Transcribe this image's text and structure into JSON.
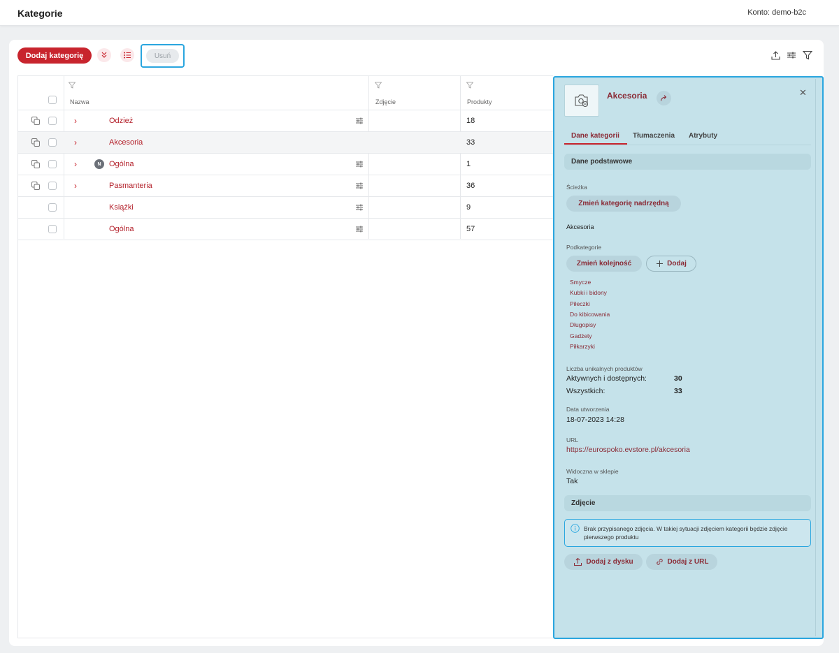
{
  "header": {
    "title": "Kategorie",
    "account": "Konto: demo-b2c"
  },
  "toolbar": {
    "add_label": "Dodaj kategorię",
    "delete_label": "Usuń"
  },
  "table": {
    "columns": {
      "name": "Nazwa",
      "image": "Zdjęcie",
      "products": "Produkty"
    },
    "rows": [
      {
        "name": "Odzież",
        "count": "18",
        "expandable": true,
        "badge": ""
      },
      {
        "name": "Akcesoria",
        "count": "33",
        "expandable": true,
        "badge": ""
      },
      {
        "name": "Ogólna",
        "count": "1",
        "expandable": true,
        "badge": "N"
      },
      {
        "name": "Pasmanteria",
        "count": "36",
        "expandable": true,
        "badge": ""
      },
      {
        "name": "Książki",
        "count": "9",
        "expandable": false,
        "badge": ""
      },
      {
        "name": "Ogólna",
        "count": "57",
        "expandable": false,
        "badge": ""
      }
    ]
  },
  "panel": {
    "title": "Akcesoria",
    "tabs": [
      "Dane kategorii",
      "Tłumaczenia",
      "Atrybuty"
    ],
    "basic_section": "Dane podstawowe",
    "path_label": "Ścieżka",
    "change_parent": "Zmień kategorię nadrzędną",
    "path_value": "Akcesoria",
    "subcategories_label": "Podkategorie",
    "change_order": "Zmień kolejność",
    "add_sub": "Dodaj",
    "subcategories": [
      "Smycze",
      "Kubki i bidony",
      "Piłeczki",
      "Do kibicowania",
      "Długopisy",
      "Gadżety",
      "Piłkarzyki"
    ],
    "unique_label": "Liczba unikalnych produktów",
    "active_label": "Aktywnych i dostępnych:",
    "active_value": "30",
    "all_label": "Wszystkich:",
    "all_value": "33",
    "created_label": "Data utworzenia",
    "created_value": "18-07-2023 14:28",
    "url_label": "URL",
    "url_value": "https://eurospoko.evstore.pl/akcesoria",
    "visible_label": "Widoczna w sklepie",
    "visible_value": "Tak",
    "image_section": "Zdjęcie",
    "info_text": "Brak przypisanego zdjęcia. W takiej sytuacji zdjęciem kategorii będzie zdjęcie pierwszego produktu",
    "add_from_disk": "Dodaj z dysku",
    "add_from_url": "Dodaj z URL"
  },
  "colors": {
    "accent": "#c8242d",
    "selection": "#2aa6df",
    "panel_bg": "#c5e2ea"
  }
}
